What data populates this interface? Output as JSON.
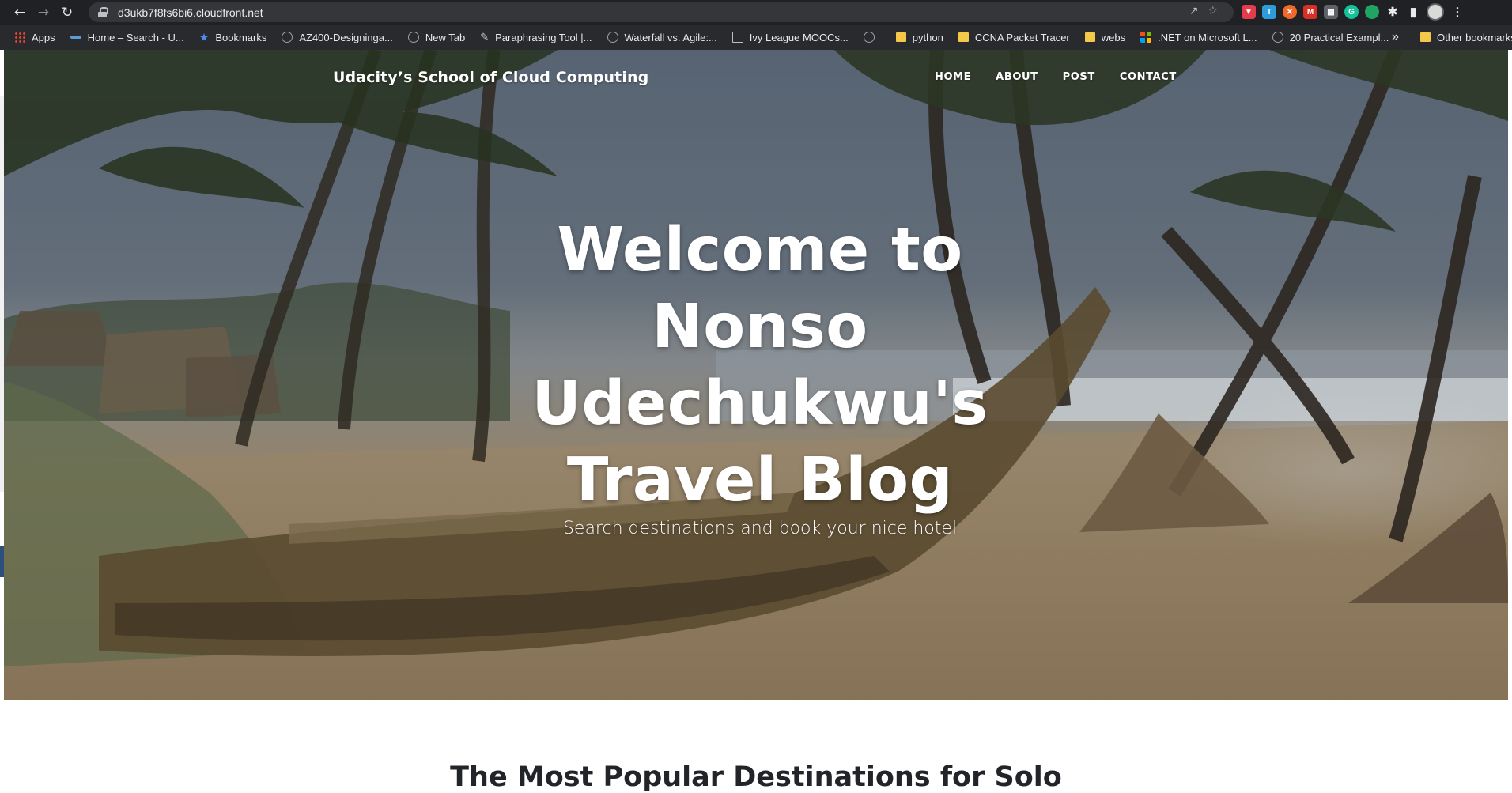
{
  "browser": {
    "url": "d3ukb7f8fs6bi6.cloudfront.net",
    "bookmarks": [
      {
        "label": "Apps",
        "icon": "apps-grid-icon"
      },
      {
        "label": "Home – Search - U...",
        "icon": "site-icon"
      },
      {
        "label": "Bookmarks",
        "icon": "star-icon"
      },
      {
        "label": "AZ400-Designinga...",
        "icon": "globe-icon"
      },
      {
        "label": "New Tab",
        "icon": "globe-icon"
      },
      {
        "label": "Paraphrasing Tool |...",
        "icon": "pen-icon"
      },
      {
        "label": "Waterfall vs. Agile:...",
        "icon": "globe-icon"
      },
      {
        "label": "Ivy League MOOCs...",
        "icon": "square-icon"
      },
      {
        "label": "",
        "icon": "globe-icon"
      },
      {
        "label": "python",
        "icon": "folder-icon"
      },
      {
        "label": "CCNA Packet Tracer",
        "icon": "folder-icon"
      },
      {
        "label": "webs",
        "icon": "folder-icon"
      },
      {
        "label": ".NET on Microsoft L...",
        "icon": "microsoft-icon"
      },
      {
        "label": "20 Practical Exampl...",
        "icon": "globe-icon"
      }
    ],
    "other_bookmarks": "Other bookmarks",
    "more_glyph": "»"
  },
  "site": {
    "brand": "Udacity’s School of Cloud Computing",
    "nav": [
      "HOME",
      "ABOUT",
      "POST",
      "CONTACT"
    ],
    "hero_title": [
      "Welcome to",
      "Nonso",
      "Udechukwu's",
      "Travel Blog"
    ],
    "hero_subtitle": "Search destinations and book your nice hotel",
    "section_heading": "The Most Popular Destinations for Solo"
  }
}
